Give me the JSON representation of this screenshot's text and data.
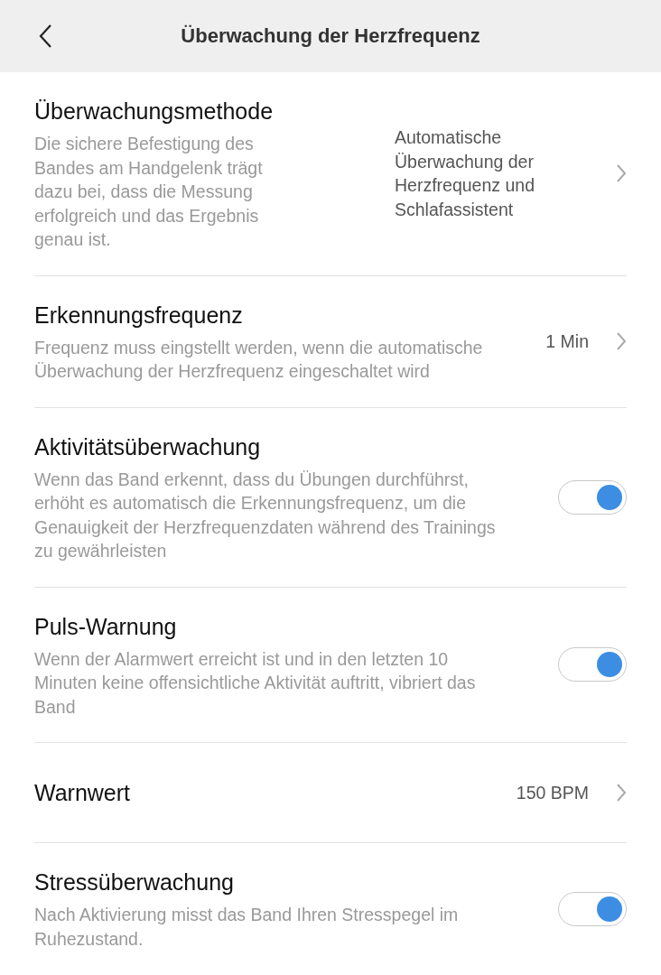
{
  "header": {
    "title": "Überwachung der Herzfrequenz"
  },
  "rows": [
    {
      "kind": "link",
      "title": "Überwachungsmethode",
      "description": "Die sichere Befestigung des Bandes am Handgelenk trägt dazu bei, dass die Messung erfolgreich und das Ergebnis genau ist.",
      "value": "Automatische Überwachung der Herzfrequenz und Schlafassistent"
    },
    {
      "kind": "link",
      "title": "Erkennungsfrequenz",
      "description": "Frequenz muss eingstellt werden, wenn die automatische Überwachung der Herzfrequenz eingeschaltet wird",
      "value": "1 Min"
    },
    {
      "kind": "toggle",
      "title": "Aktivitätsüberwachung",
      "description": "Wenn das Band erkennt, dass du Übungen durchführst, erhöht es automatisch die Erkennungsfrequenz, um die Genauigkeit der Herzfrequenzdaten während des Trainings zu gewährleisten",
      "on": true
    },
    {
      "kind": "toggle",
      "title": "Puls-Warnung",
      "description": "Wenn der Alarmwert erreicht ist und in den letzten 10 Minuten keine offensichtliche Aktivität auftritt, vibriert das Band",
      "on": true
    },
    {
      "kind": "link",
      "title": "Warnwert",
      "value": "150 BPM"
    },
    {
      "kind": "toggle",
      "title": "Stressüberwachung",
      "description": "Nach Aktivierung misst das Band Ihren Stresspegel im Ruhezustand.",
      "on": true
    }
  ]
}
